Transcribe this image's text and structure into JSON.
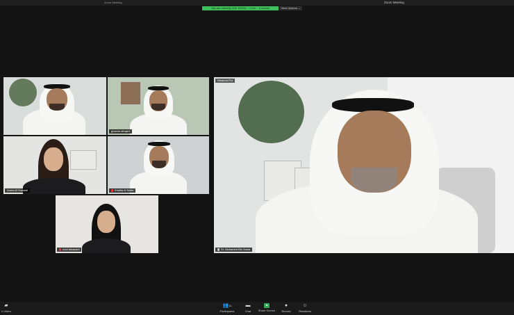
{
  "topbar": {
    "app_title": "Zoom Meeting",
    "window_title": "Zoom Meeting"
  },
  "share": {
    "banner": "You are viewing UAE MOHIC - Chai... 's screen",
    "view_options": "View Options ⌄"
  },
  "main_speaker": {
    "tag": "Reserva Pro",
    "name": "Dr. Mohamed Bin Zama"
  },
  "participants": [
    {
      "name": ""
    },
    {
      "name": "ghanim.alhajeri"
    },
    {
      "name": "Amna Al Suwaidi"
    },
    {
      "name": "Khalifa Al Malla"
    },
    {
      "name": "nouf alwazani"
    }
  ],
  "toolbar": {
    "video_label": "rt Video",
    "participants_label": "Participants",
    "participants_count": "11",
    "chat_label": "Chat",
    "share_label": "Share Screen",
    "record_label": "Record",
    "reactions_label": "Reactions"
  }
}
